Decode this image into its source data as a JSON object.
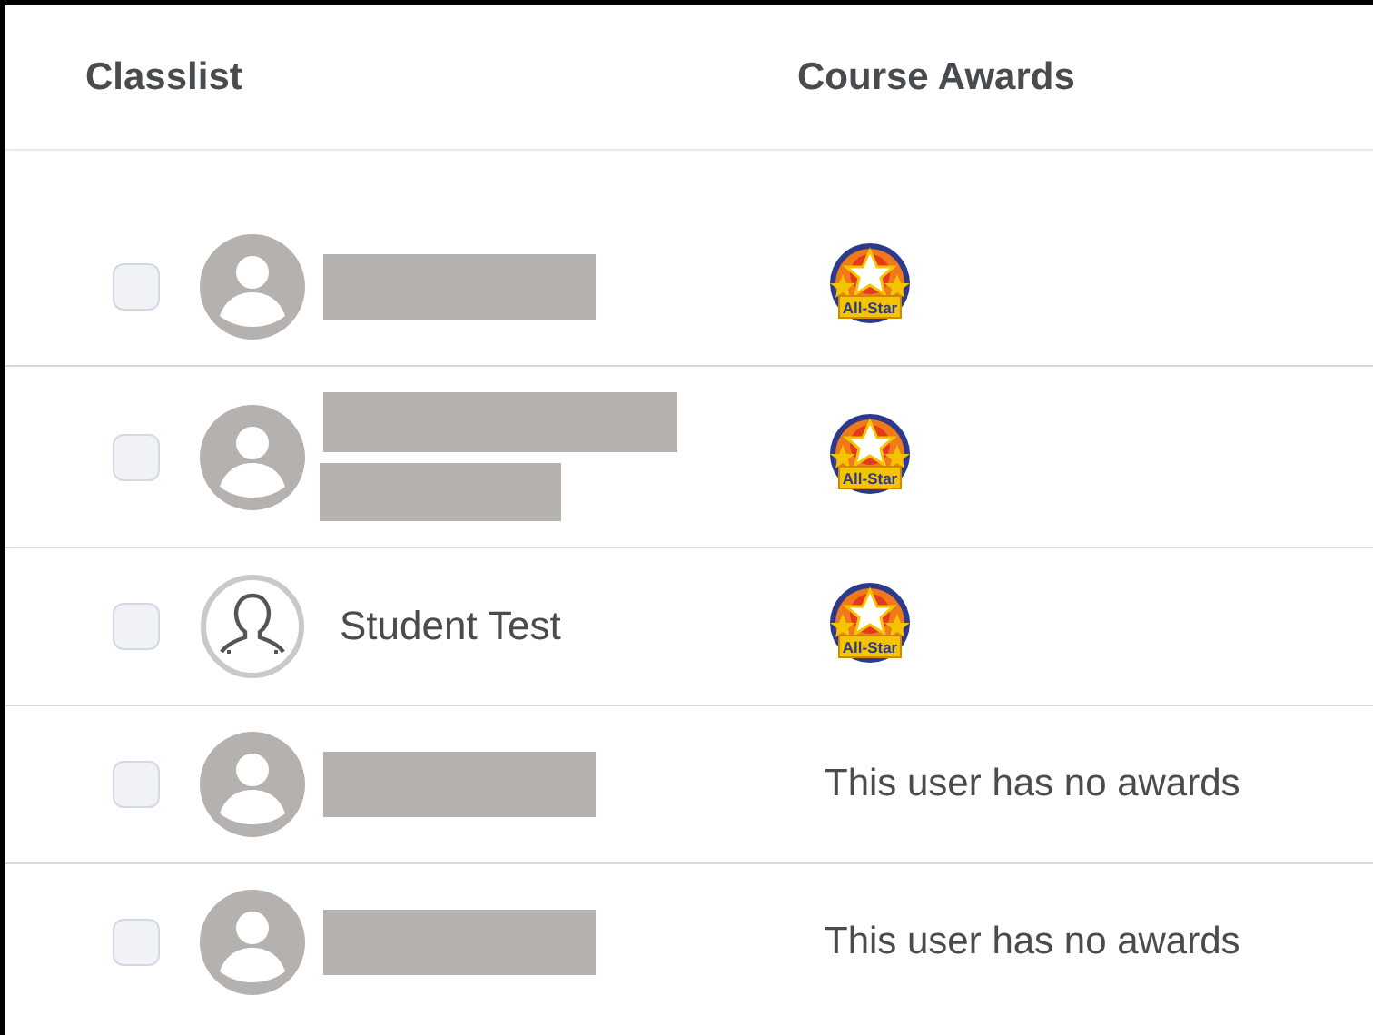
{
  "table": {
    "columns": [
      "Classlist",
      "Course Awards"
    ],
    "rows": [
      {
        "checked": false,
        "avatar": {
          "kind": "default"
        },
        "name": {
          "kind": "redacted",
          "wrapped": false
        },
        "awards": [
          {
            "label": "All-Star"
          }
        ]
      },
      {
        "checked": false,
        "avatar": {
          "kind": "default"
        },
        "name": {
          "kind": "redacted",
          "wrapped": true
        },
        "awards": [
          {
            "label": "All-Star"
          }
        ]
      },
      {
        "checked": false,
        "avatar": {
          "kind": "outline"
        },
        "name": {
          "kind": "text",
          "text": "Student Test"
        },
        "awards": [
          {
            "label": "All-Star"
          }
        ]
      },
      {
        "checked": false,
        "avatar": {
          "kind": "default"
        },
        "name": {
          "kind": "redacted",
          "wrapped": false
        },
        "no_awards": "This user has no awards"
      },
      {
        "checked": false,
        "avatar": {
          "kind": "default"
        },
        "name": {
          "kind": "redacted",
          "wrapped": false
        },
        "no_awards": "This user has no awards"
      }
    ]
  }
}
